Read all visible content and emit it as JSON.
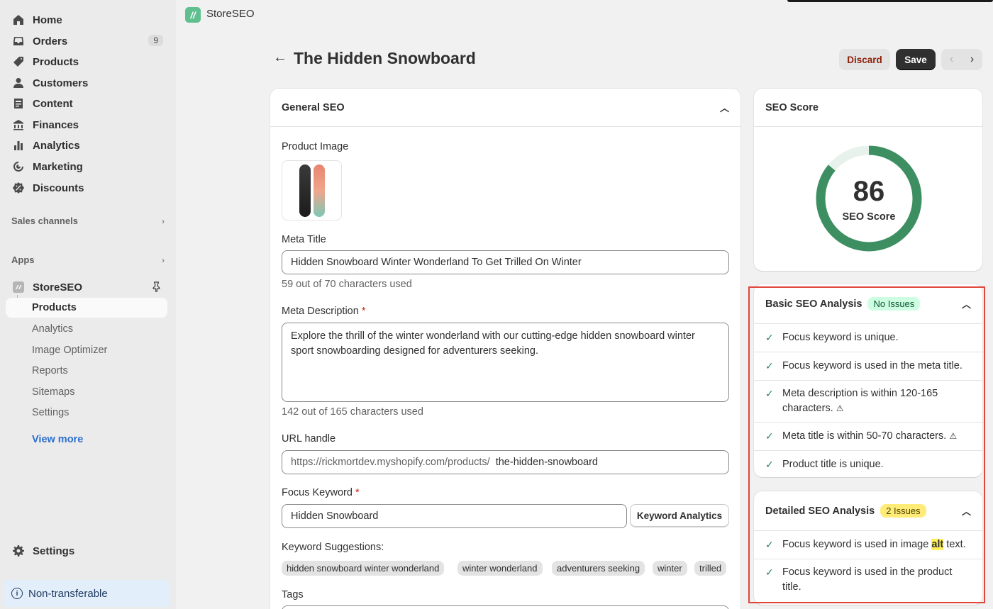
{
  "sidebar": {
    "items": [
      {
        "label": "Home",
        "icon": "home-icon"
      },
      {
        "label": "Orders",
        "icon": "inbox-icon",
        "badge": "9"
      },
      {
        "label": "Products",
        "icon": "tag-icon"
      },
      {
        "label": "Customers",
        "icon": "person-icon"
      },
      {
        "label": "Content",
        "icon": "content-icon"
      },
      {
        "label": "Finances",
        "icon": "bank-icon"
      },
      {
        "label": "Analytics",
        "icon": "bar-chart-icon"
      },
      {
        "label": "Marketing",
        "icon": "target-icon"
      },
      {
        "label": "Discounts",
        "icon": "discount-icon"
      }
    ],
    "sales_channels": "Sales channels",
    "apps": "Apps",
    "app_name": "StoreSEO",
    "app_sub_items": [
      "Products",
      "Analytics",
      "Image Optimizer",
      "Reports",
      "Sitemaps",
      "Settings"
    ],
    "view_more": "View more",
    "settings": "Settings",
    "non_transferable": "Non-transferable"
  },
  "topbar": {
    "app_name": "StoreSEO"
  },
  "header": {
    "title": "The Hidden Snowboard",
    "discard": "Discard",
    "save": "Save",
    "prev": "‹",
    "next": "›"
  },
  "general_seo": {
    "title": "General SEO",
    "product_image_label": "Product Image",
    "meta_title_label": "Meta Title",
    "meta_title_value": "Hidden Snowboard Winter Wonderland To Get Trilled On Winter",
    "meta_title_helper": "59 out of 70 characters used",
    "meta_desc_label": "Meta Description",
    "meta_desc_value": "Explore the thrill of the winter wonderland with our cutting-edge hidden snowboard winter sport snowboarding designed for adventurers seeking.",
    "meta_desc_helper": "142 out of 165 characters used",
    "url_label": "URL handle",
    "url_prefix": "https://rickmortdev.myshopify.com/products/",
    "url_value": "the-hidden-snowboard",
    "focus_label": "Focus Keyword",
    "focus_value": "Hidden Snowboard",
    "keyword_analytics": "Keyword Analytics",
    "suggestions_label": "Keyword Suggestions:",
    "suggestions": [
      "hidden snowboard winter wonderland",
      "winter wonderland",
      "adventurers seeking",
      "winter",
      "trilled"
    ],
    "tags_label": "Tags",
    "required_mark": "*"
  },
  "seo_score": {
    "title": "SEO Score",
    "score": 86,
    "score_label": "SEO Score",
    "colors": {
      "ring": "#3d8f62",
      "track": "#e8f2ec"
    }
  },
  "basic_analysis": {
    "title": "Basic SEO Analysis",
    "badge": "No Issues",
    "items": [
      "Focus keyword is unique.",
      "Focus keyword is used in the meta title.",
      "Meta description is within 120-165 characters.",
      "Meta title is within 50-70 characters.",
      "Product title is unique."
    ]
  },
  "detailed_analysis": {
    "title": "Detailed SEO Analysis",
    "badge": "2 Issues",
    "item1_before": "Focus keyword is used in image ",
    "item1_highlight": "alt",
    "item1_after": " text.",
    "item2": "Focus keyword is used in the product title."
  }
}
